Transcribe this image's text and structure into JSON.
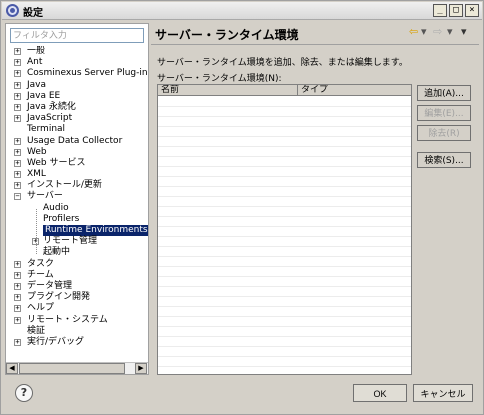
{
  "window": {
    "title": "設定",
    "controls": {
      "minimize": "_",
      "maximize": "□",
      "close": "×"
    }
  },
  "filter": {
    "placeholder": "フィルタ入力",
    "value": ""
  },
  "tree": [
    {
      "label": "一般",
      "expander": "+"
    },
    {
      "label": "Ant",
      "expander": "+"
    },
    {
      "label": "Cosminexus Server Plug-in",
      "expander": "+"
    },
    {
      "label": "Java",
      "expander": "+"
    },
    {
      "label": "Java EE",
      "expander": "+"
    },
    {
      "label": "Java 永続化",
      "expander": "+"
    },
    {
      "label": "JavaScript",
      "expander": "+"
    },
    {
      "label": "Terminal",
      "expander": ""
    },
    {
      "label": "Usage Data Collector",
      "expander": "+"
    },
    {
      "label": "Web",
      "expander": "+"
    },
    {
      "label": "Web サービス",
      "expander": "+"
    },
    {
      "label": "XML",
      "expander": "+"
    },
    {
      "label": "インストール/更新",
      "expander": "+"
    },
    {
      "label": "サーバー",
      "expander": "−"
    },
    {
      "label": "Audio",
      "expander": ""
    },
    {
      "label": "Profilers",
      "expander": ""
    },
    {
      "label": "Runtime Environments",
      "expander": "",
      "selected": true
    },
    {
      "label": "リモート管理",
      "expander": "+"
    },
    {
      "label": "起動中",
      "expander": ""
    },
    {
      "label": "タスク",
      "expander": "+"
    },
    {
      "label": "チーム",
      "expander": "+"
    },
    {
      "label": "データ管理",
      "expander": "+"
    },
    {
      "label": "プラグイン開発",
      "expander": "+"
    },
    {
      "label": "ヘルプ",
      "expander": "+"
    },
    {
      "label": "リモート・システム",
      "expander": "+"
    },
    {
      "label": "検証",
      "expander": ""
    },
    {
      "label": "実行/デバッグ",
      "expander": "+"
    }
  ],
  "page": {
    "title": "サーバー・ランタイム環境",
    "description": "サーバー・ランタイム環境を追加、除去、または編集します。",
    "table_label": "サーバー・ランタイム環境(N):",
    "columns": [
      "名前",
      "タイプ"
    ],
    "nav": {
      "back": "⇦",
      "forward": "⇨",
      "dropdown": "▾",
      "menu": "▾"
    }
  },
  "buttons": {
    "add": "追加(A)...",
    "edit": "編集(E)...",
    "remove": "除去(R)",
    "search": "検索(S)..."
  },
  "footer": {
    "help": "?",
    "ok": "OK",
    "cancel": "キャンセル"
  },
  "scroll": {
    "left": "◀",
    "right": "▶"
  }
}
